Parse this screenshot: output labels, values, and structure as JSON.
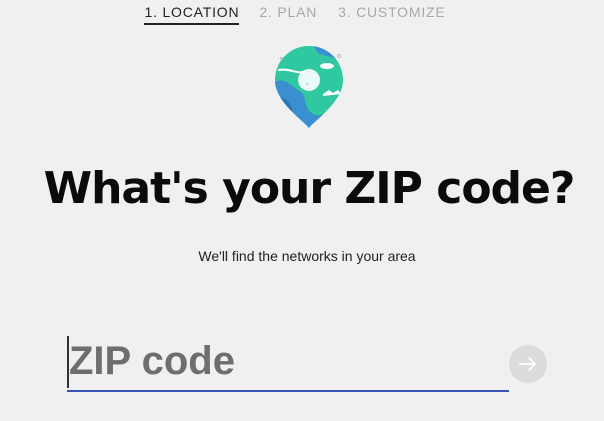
{
  "steps": [
    {
      "label": "1. LOCATION",
      "active": true
    },
    {
      "label": "2. PLAN",
      "active": false
    },
    {
      "label": "3. CUSTOMIZE",
      "active": false
    }
  ],
  "hero": {
    "icon": "location-globe-pin-icon",
    "headline": "What's your ZIP code?",
    "subtext": "We'll find the networks in your area"
  },
  "zip_field": {
    "placeholder": "ZIP code",
    "value": ""
  },
  "submit": {
    "icon": "arrow-right-icon"
  },
  "colors": {
    "background": "#f0f0f0",
    "active_step": "#222222",
    "inactive_step": "#a8a8a8",
    "input_underline": "#3a55b8",
    "pin_green": "#2fc8a0",
    "pin_blue": "#3a8fd0",
    "submit_bg": "#dcdcdc"
  }
}
